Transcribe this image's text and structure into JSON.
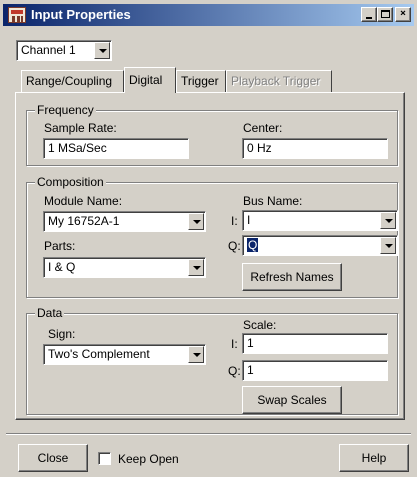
{
  "window": {
    "title": "Input Properties",
    "minimize_label": "_",
    "maximize_label": "□",
    "close_label": "×"
  },
  "channel": {
    "selected": "Channel 1"
  },
  "tabs": [
    {
      "label": "Range/Coupling",
      "active": false,
      "enabled": true
    },
    {
      "label": "Digital",
      "active": true,
      "enabled": true
    },
    {
      "label": "Trigger",
      "active": false,
      "enabled": true
    },
    {
      "label": "Playback Trigger",
      "active": false,
      "enabled": false
    }
  ],
  "frequency": {
    "group_label": "Frequency",
    "sample_rate_label": "Sample Rate:",
    "sample_rate_value": "1 MSa/Sec",
    "center_label": "Center:",
    "center_value": "0 Hz"
  },
  "composition": {
    "group_label": "Composition",
    "module_name_label": "Module Name:",
    "module_name_value": "My 16752A-1",
    "parts_label": "Parts:",
    "parts_value": "I & Q",
    "bus_name_label": "Bus Name:",
    "i_label": "I:",
    "i_value": "I",
    "q_label": "Q:",
    "q_value": "Q",
    "refresh_label": "Refresh Names"
  },
  "data_group": {
    "group_label": "Data",
    "sign_label": "Sign:",
    "sign_value": "Two's Complement",
    "scale_label": "Scale:",
    "i_label": "I:",
    "i_scale": "1",
    "q_label": "Q:",
    "q_scale": "1",
    "swap_label": "Swap Scales"
  },
  "footer": {
    "close_label": "Close",
    "keep_open_label": "Keep Open",
    "keep_open_checked": false,
    "help_label": "Help"
  },
  "colors": {
    "titlebar_start": "#0a246a",
    "titlebar_end": "#a6caf0",
    "face": "#d4d0c8",
    "selection": "#0a246a"
  }
}
